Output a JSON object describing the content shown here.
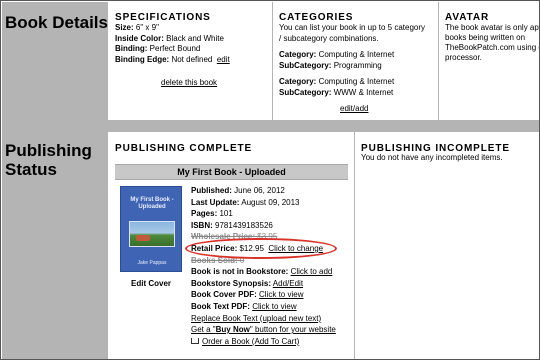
{
  "details": {
    "section_label": "Book Details",
    "specifications": {
      "header": "SPECIFICATIONS",
      "size_label": "Size:",
      "size_value": "6\" x 9\"",
      "inside_label": "Inside Color:",
      "inside_value": "Black and White",
      "binding_label": "Binding:",
      "binding_value": "Perfect Bound",
      "edge_label": "Binding Edge:",
      "edge_value": "Not defined",
      "edit_link": "edit",
      "delete_link": "delete this book"
    },
    "categories": {
      "header": "CATEGORIES",
      "desc_line1": "You can list your book in up to 5 category",
      "desc_line2": "/ subcategory combinations.",
      "entries": [
        {
          "cat_label": "Category:",
          "cat_value": "Computing & Internet",
          "sub_label": "SubCategory:",
          "sub_value": "Programming"
        },
        {
          "cat_label": "Category:",
          "cat_value": "Computing & Internet",
          "sub_label": "SubCategory:",
          "sub_value": "WWW & Internet"
        }
      ],
      "edit_add_link": "edit/add"
    },
    "avatar": {
      "header": "AVATAR",
      "line1": "The book avatar is only ap",
      "line2": "books being written on",
      "line3": "TheBookPatch.com using o",
      "line4": "processor."
    }
  },
  "publishing": {
    "section_label_line1": "Publishing",
    "section_label_line2": "Status",
    "complete": {
      "header": "PUBLISHING COMPLETE",
      "book_title_bar": "My First Book - Uploaded",
      "cover": {
        "title": "My First Book - Uploaded",
        "author": "Jake Pappas"
      },
      "edit_cover": "Edit Cover",
      "published_label": "Published:",
      "published_value": "June 06, 2012",
      "last_update_label": "Last Update:",
      "last_update_value": "August 09, 2013",
      "pages_label": "Pages:",
      "pages_value": "101",
      "isbn_label": "ISBN:",
      "isbn_value": "9781439183526",
      "wholesale_label": "Wholesale Price:",
      "wholesale_value": "$3.95",
      "retail_label": "Retail Price:",
      "retail_value": "$12.95",
      "retail_link": "Click to change",
      "books_sold_label": "Books Sold:",
      "books_sold_value": "0",
      "bookstore_label": "Book is not in Bookstore:",
      "bookstore_link": "Click to add",
      "synopsis_label": "Bookstore Synopsis:",
      "synopsis_link": "Add/Edit",
      "cover_pdf_label": "Book Cover PDF:",
      "cover_pdf_link": "Click to view",
      "text_pdf_label": "Book Text PDF:",
      "text_pdf_link": "Click to view",
      "replace_link": "Replace Book Text (upload new text)",
      "buy_now_prefix": "Get a \"",
      "buy_now_bold": "Buy Now",
      "buy_now_suffix": "\" button for your website",
      "order_link": "Order a Book (Add To Cart)"
    },
    "incomplete": {
      "header": "PUBLISHING INCOMPLETE",
      "message": "You do not have any incompleted items."
    }
  },
  "colors": {
    "label_band": "#b4b4b4",
    "highlight_oval": "#d8322a",
    "cover_blue": "#3f64b4"
  }
}
